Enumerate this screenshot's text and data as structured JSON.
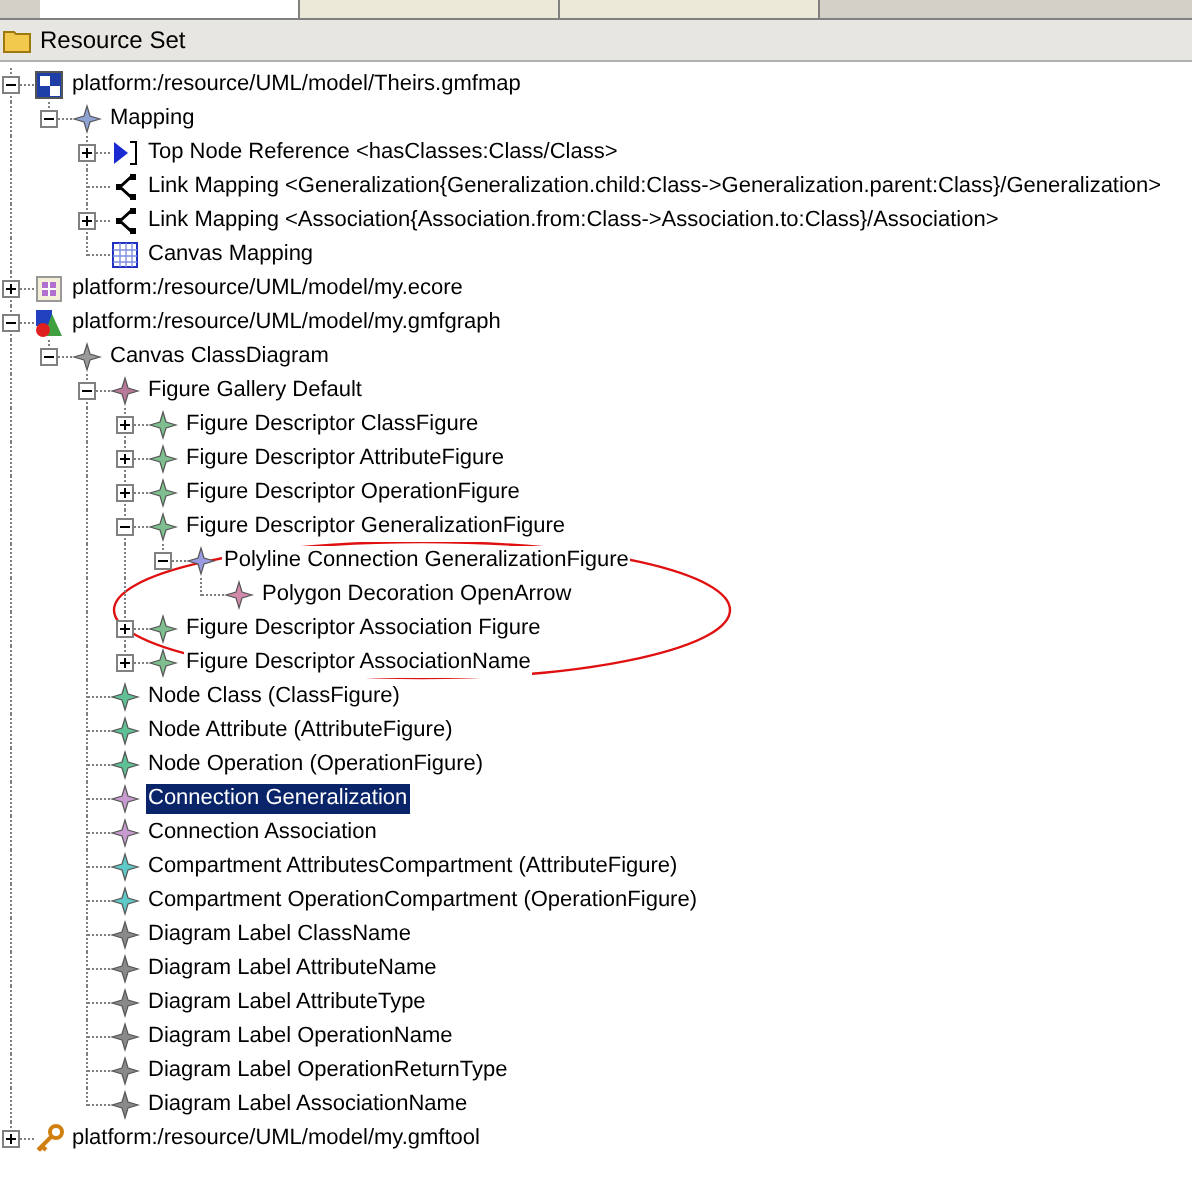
{
  "editor_tabs": [
    {
      "selected": true
    },
    {
      "selected": false
    },
    {
      "selected": false
    }
  ],
  "header": {
    "title": "Resource Set"
  },
  "tree": [
    {
      "label": "platform:/resource/UML/model/Theirs.gmfmap",
      "kind": "gmfmap",
      "selected": false,
      "expanded": true,
      "children": [
        {
          "label": "Mapping",
          "kind": "mapping",
          "selected": false,
          "expanded": true,
          "children": [
            {
              "label": "Top Node Reference <hasClasses:Class/Class>",
              "kind": "topnode",
              "selected": false,
              "expanded": false
            },
            {
              "label": "Link Mapping <Generalization{Generalization.child:Class->Generalization.parent:Class}/Generalization>",
              "kind": "link",
              "selected": false
            },
            {
              "label": "Link Mapping <Association{Association.from:Class->Association.to:Class}/Association>",
              "kind": "link",
              "selected": false,
              "expanded": false
            },
            {
              "label": "Canvas Mapping",
              "kind": "canvasmap",
              "selected": false
            }
          ]
        }
      ]
    },
    {
      "label": "platform:/resource/UML/model/my.ecore",
      "kind": "ecore",
      "selected": false,
      "expanded": false
    },
    {
      "label": "platform:/resource/UML/model/my.gmfgraph",
      "kind": "gmfgraph",
      "selected": false,
      "expanded": true,
      "children": [
        {
          "label": "Canvas ClassDiagram",
          "kind": "canvas",
          "selected": false,
          "expanded": true,
          "children": [
            {
              "label": "Figure Gallery Default",
              "kind": "gallery",
              "selected": false,
              "expanded": true,
              "children": [
                {
                  "label": "Figure Descriptor ClassFigure",
                  "kind": "figure",
                  "selected": false,
                  "expanded": false
                },
                {
                  "label": "Figure Descriptor AttributeFigure",
                  "kind": "figure",
                  "selected": false,
                  "expanded": false
                },
                {
                  "label": "Figure Descriptor OperationFigure",
                  "kind": "figure",
                  "selected": false,
                  "expanded": false
                },
                {
                  "label": "Figure Descriptor GeneralizationFigure",
                  "kind": "figure",
                  "selected": false,
                  "expanded": true,
                  "children": [
                    {
                      "label": "Polyline Connection GeneralizationFigure",
                      "kind": "polyline",
                      "selected": false,
                      "expanded": true,
                      "children": [
                        {
                          "label": "Polygon Decoration OpenArrow",
                          "kind": "decoration",
                          "selected": false
                        }
                      ]
                    }
                  ]
                },
                {
                  "label": "Figure Descriptor Association Figure",
                  "kind": "figure",
                  "selected": false,
                  "expanded": false
                },
                {
                  "label": "Figure Descriptor AssociationName",
                  "kind": "figure",
                  "selected": false,
                  "expanded": false
                }
              ]
            },
            {
              "label": "Node Class (ClassFigure)",
              "kind": "node",
              "selected": false
            },
            {
              "label": "Node Attribute (AttributeFigure)",
              "kind": "node",
              "selected": false
            },
            {
              "label": "Node Operation (OperationFigure)",
              "kind": "node",
              "selected": false
            },
            {
              "label": "Connection Generalization",
              "kind": "connection",
              "selected": true
            },
            {
              "label": "Connection Association",
              "kind": "connection",
              "selected": false
            },
            {
              "label": "Compartment AttributesCompartment (AttributeFigure)",
              "kind": "compartment",
              "selected": false
            },
            {
              "label": "Compartment OperationCompartment (OperationFigure)",
              "kind": "compartment",
              "selected": false
            },
            {
              "label": "Diagram Label ClassName",
              "kind": "label",
              "selected": false
            },
            {
              "label": "Diagram Label AttributeName",
              "kind": "label",
              "selected": false
            },
            {
              "label": "Diagram Label AttributeType",
              "kind": "label",
              "selected": false
            },
            {
              "label": "Diagram Label OperationName",
              "kind": "label",
              "selected": false
            },
            {
              "label": "Diagram Label OperationReturnType",
              "kind": "label",
              "selected": false
            },
            {
              "label": "Diagram Label AssociationName",
              "kind": "label",
              "selected": false
            }
          ]
        }
      ]
    },
    {
      "label": "platform:/resource/UML/model/my.gmftool",
      "kind": "gmftool",
      "selected": false,
      "expanded": false
    }
  ]
}
